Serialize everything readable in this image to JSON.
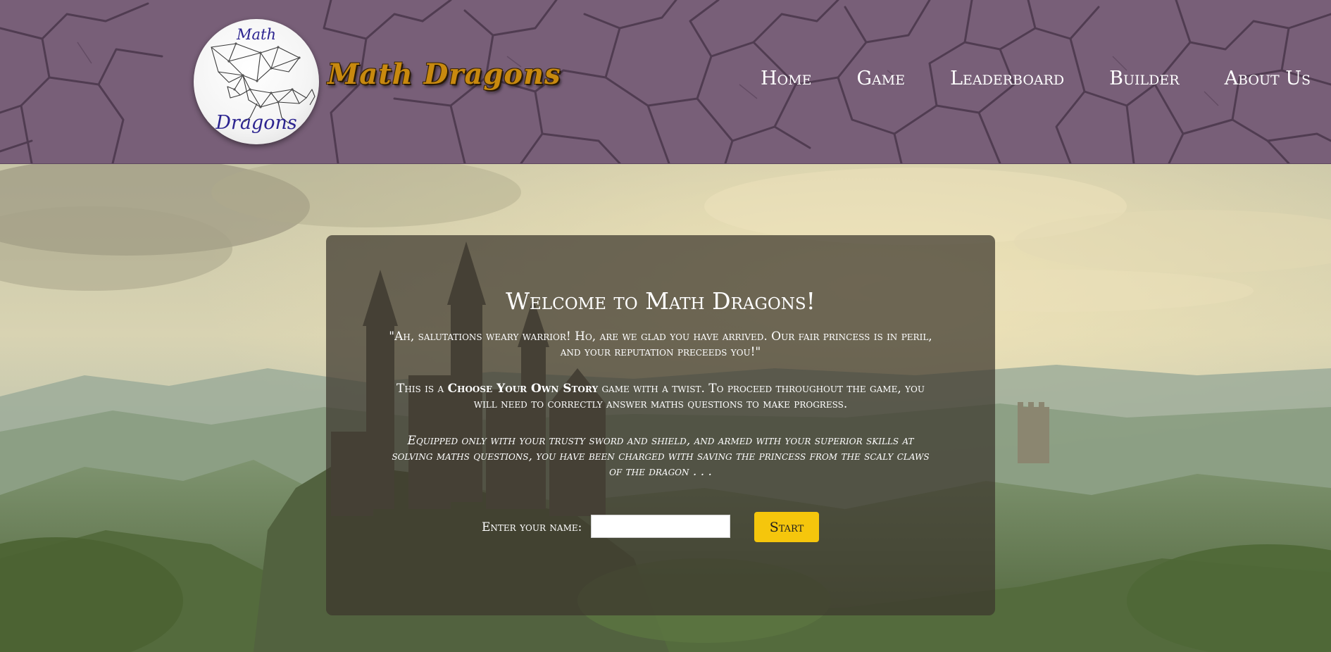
{
  "brand": {
    "logo_top": "Math",
    "logo_bottom": "Dragons",
    "title": "Math Dragons"
  },
  "nav": {
    "home": "Home",
    "game": "Game",
    "leaderboard": "Leaderboard",
    "builder": "Builder",
    "about": "About Us"
  },
  "main": {
    "title": "Welcome to Math Dragons!",
    "quote": "\"Ah, salutations weary warrior! Ho, are we glad you have arrived. Our fair princess is in peril, and your reputation preceeds you!\"",
    "intro_before": "This is a ",
    "intro_strong": "Choose Your Own Story",
    "intro_after": " game with a twist. To proceed throughout the game, you will need to correctly answer maths questions to make progress.",
    "story": "Equipped only with your trusty sword and shield, and armed with your superior skills at solving maths questions, you have been charged with saving the princess from the scaly claws of the dragon . . .",
    "name_label": "Enter your name:",
    "name_value": "",
    "start_label": "Start"
  },
  "colors": {
    "header_bg": "#785f78",
    "brand_gold": "#c8890f",
    "start_button": "#f5c60c",
    "logo_text": "#2c2490"
  }
}
